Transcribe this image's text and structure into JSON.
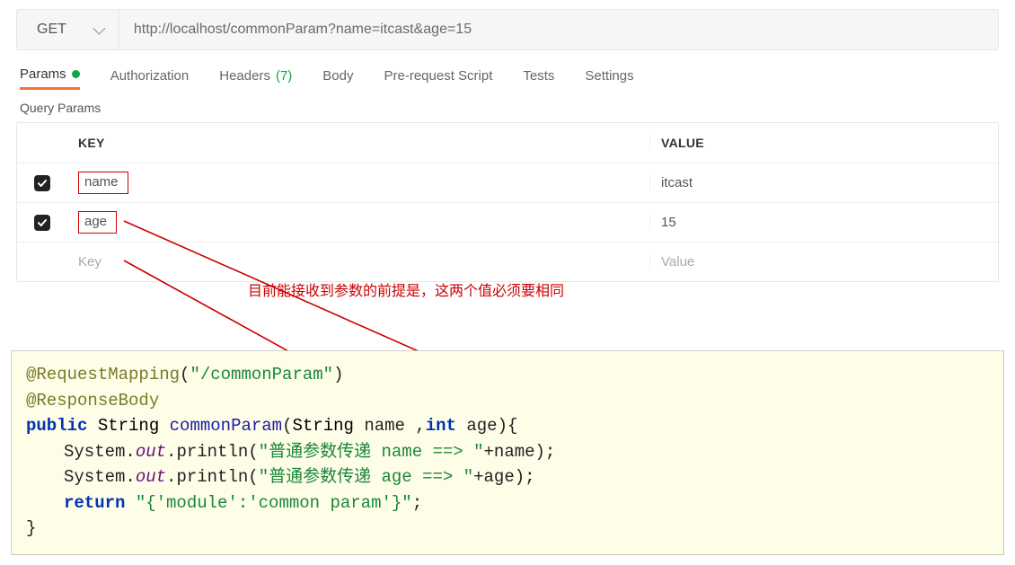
{
  "request": {
    "method": "GET",
    "url": "http://localhost/commonParam?name=itcast&age=15"
  },
  "tabs": {
    "params": "Params",
    "authorization": "Authorization",
    "headers": "Headers",
    "headers_count": "(7)",
    "body": "Body",
    "prerequest": "Pre-request Script",
    "tests": "Tests",
    "settings": "Settings"
  },
  "section_title": "Query Params",
  "table": {
    "header_key": "KEY",
    "header_value": "VALUE",
    "rows": [
      {
        "checked": true,
        "key": "name",
        "value": "itcast"
      },
      {
        "checked": true,
        "key": "age",
        "value": "15"
      }
    ],
    "placeholder_key": "Key",
    "placeholder_value": "Value"
  },
  "annotation": "目前能接收到参数的前提是，这两个值必须要相同",
  "code": {
    "anno1_name": "@RequestMapping",
    "anno1_arg": "\"/commonParam\"",
    "anno2": "@ResponseBody",
    "mod_public": "public",
    "ret_type": "String",
    "method_name": "commonParam",
    "param1_type": "String",
    "param1_name": "name",
    "param2_type": "int",
    "param2_name": "age",
    "sys": "System",
    "out": "out",
    "println": "println",
    "str1": "\"普通参数传递 name ==> \"",
    "plus_name": "+name",
    "str2": "\"普通参数传递 age ==> \"",
    "plus_age": "+age",
    "return_kw": "return",
    "return_val": "\"{'module':'common param'}\""
  }
}
